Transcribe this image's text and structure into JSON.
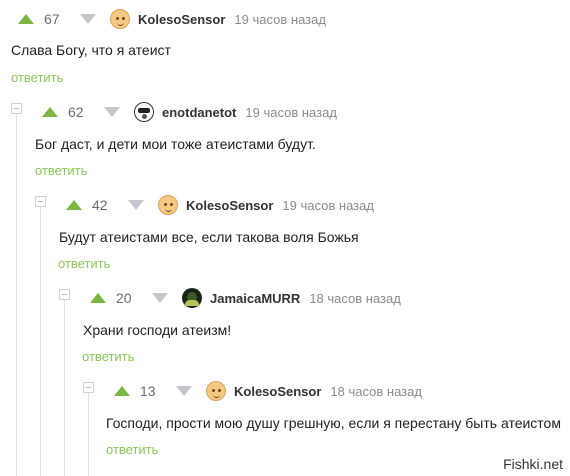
{
  "comments": [
    {
      "rating": "67",
      "username": "KolesoSensor",
      "time": "19 часов назад",
      "text": "Слава Богу, что я атеист",
      "reply": "ответить",
      "avatar": "face-avatar"
    },
    {
      "rating": "62",
      "username": "enotdanetot",
      "time": "19 часов назад",
      "text": "Бог даст, и дети мои тоже атеистами будут.",
      "reply": "ответить",
      "avatar": "raccoon-avatar"
    },
    {
      "rating": "42",
      "username": "KolesoSensor",
      "time": "19 часов назад",
      "text": "Будут атеистами все, если такова воля Божья",
      "reply": "ответить",
      "avatar": "face-avatar"
    },
    {
      "rating": "20",
      "username": "JamaicaMURR",
      "time": "18 часов назад",
      "text": "Храни господи атеизм!",
      "reply": "ответить",
      "avatar": "jamaica-avatar"
    },
    {
      "rating": "13",
      "username": "KolesoSensor",
      "time": "18 часов назад",
      "text": "Господи, прости мою душу грешную, если я перестану быть атеистом",
      "reply": "ответить",
      "avatar": "face-avatar"
    }
  ],
  "watermark": "Fishki.net",
  "colors": {
    "upvote": "#7bb843",
    "downvote": "#c3c6cb",
    "reply_link": "#8ac858",
    "thread_line": "#dfe3e6"
  }
}
